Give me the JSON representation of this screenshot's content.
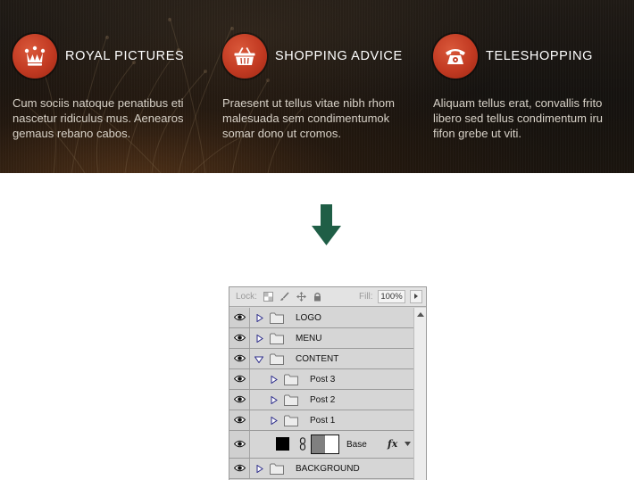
{
  "features": [
    {
      "icon": "crown-icon",
      "title": "ROYAL PICTURES",
      "desc_lines": [
        "Cum sociis natoque penatibus eti",
        "nascetur ridiculus mus. Aenearos",
        "gemaus rebano cabos."
      ]
    },
    {
      "icon": "shopping-basket-icon",
      "title": "SHOPPING ADVICE",
      "desc_lines": [
        "Praesent ut tellus vitae nibh rhom",
        "malesuada sem condimentumok",
        "somar dono ut cromos."
      ]
    },
    {
      "icon": "telephone-icon",
      "title": "TELESHOPPING",
      "desc_lines": [
        "Aliquam tellus erat, convallis frito",
        "libero sed tellus condimentum iru",
        "fifon grebe ut viti."
      ]
    }
  ],
  "colors": {
    "badge_red": "#c23a22",
    "arrow_green": "#1f5e46",
    "panel_bg": "#d6d6d6"
  },
  "panel": {
    "lock_label": "Lock:",
    "fill_label": "Fill:",
    "fill_value": "100%",
    "layers": {
      "logo": "LOGO",
      "menu": "MENU",
      "content": "CONTENT",
      "post3": "Post 3",
      "post2": "Post 2",
      "post1": "Post 1",
      "base": "Base",
      "background": "BACKGROUND"
    },
    "fx_label": "fx"
  }
}
